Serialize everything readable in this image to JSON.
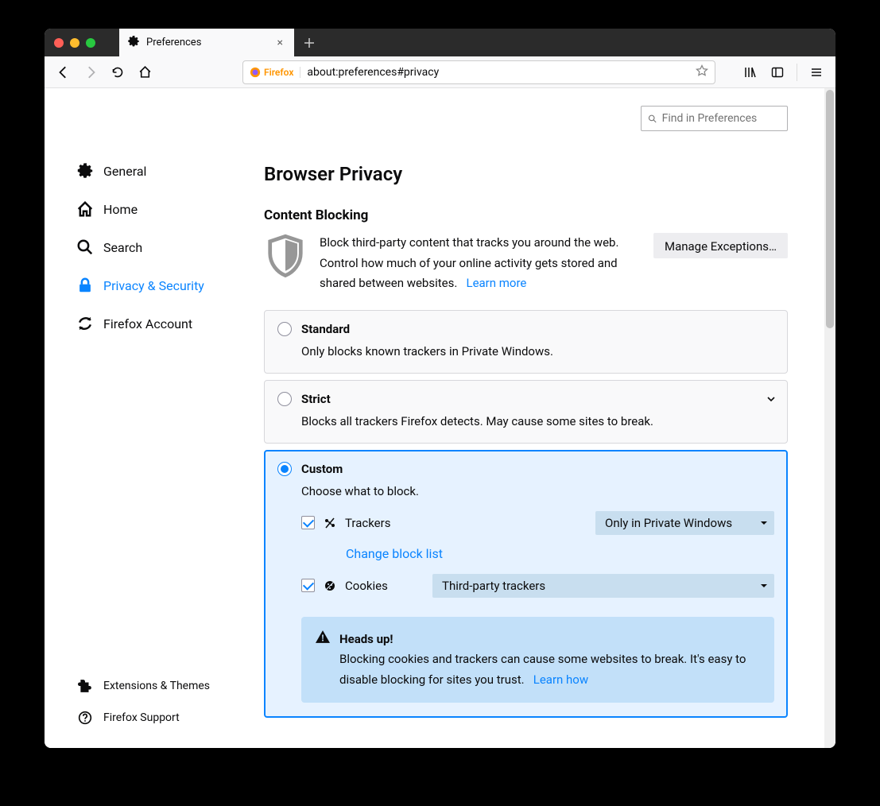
{
  "tab": {
    "title": "Preferences"
  },
  "urlbar": {
    "brand": "Firefox",
    "url": "about:preferences#privacy"
  },
  "search": {
    "placeholder": "Find in Preferences"
  },
  "sidebar": {
    "items": [
      {
        "label": "General"
      },
      {
        "label": "Home"
      },
      {
        "label": "Search"
      },
      {
        "label": "Privacy & Security"
      },
      {
        "label": "Firefox Account"
      }
    ],
    "bottom": [
      {
        "label": "Extensions & Themes"
      },
      {
        "label": "Firefox Support"
      }
    ]
  },
  "page": {
    "title": "Browser Privacy",
    "section": "Content Blocking",
    "intro": "Block third-party content that tracks you around the web. Control how much of your online activity gets stored and shared between websites.",
    "learn_more": "Learn more",
    "manage": "Manage Exceptions…"
  },
  "cards": {
    "standard": {
      "title": "Standard",
      "desc": "Only blocks known trackers in Private Windows."
    },
    "strict": {
      "title": "Strict",
      "desc": "Blocks all trackers Firefox detects. May cause some sites to break."
    },
    "custom": {
      "title": "Custom",
      "desc": "Choose what to block.",
      "trackers_label": "Trackers",
      "trackers_select": "Only in Private Windows",
      "change_block_list": "Change block list",
      "cookies_label": "Cookies",
      "cookies_select": "Third-party trackers"
    }
  },
  "headsup": {
    "title": "Heads up!",
    "body": "Blocking cookies and trackers can cause some websites to break. It's easy to disable blocking for sites you trust.",
    "learn_how": "Learn how"
  }
}
